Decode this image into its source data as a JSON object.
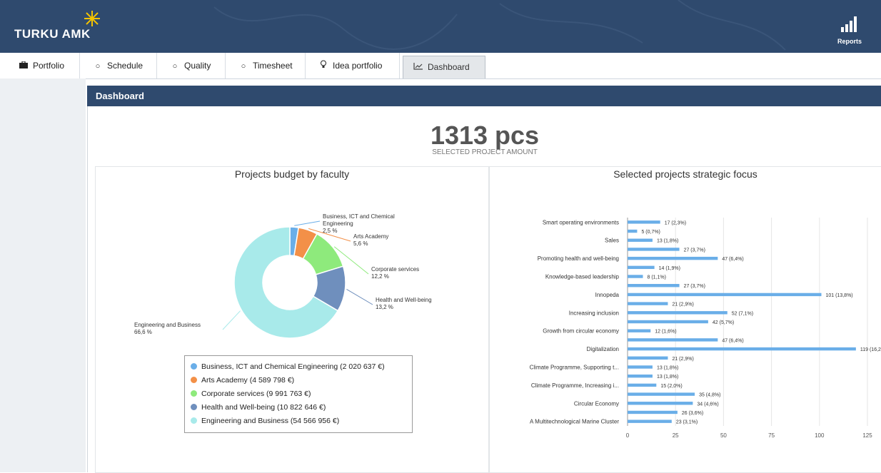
{
  "header": {
    "logo_text": "TURKU AMK",
    "reports_label": "Reports",
    "colors": {
      "bar": "#2f4a6e",
      "accent": "#f5c400"
    }
  },
  "tabs": [
    {
      "label": "Portfolio",
      "icon": "briefcase-icon"
    },
    {
      "label": "Schedule",
      "icon": "circle-icon"
    },
    {
      "label": "Quality",
      "icon": "circle-icon"
    },
    {
      "label": "Timesheet",
      "icon": "circle-icon"
    },
    {
      "label": "Idea portfolio",
      "icon": "lightbulb-icon"
    },
    {
      "label": "Dashboard",
      "icon": "line-chart-icon",
      "active": true
    }
  ],
  "panel": {
    "title": "Dashboard"
  },
  "summary": {
    "value": "1313 pcs",
    "label": "SELECTED PROJECT AMOUNT"
  },
  "chart_data": [
    {
      "type": "pie",
      "title": "Projects budget by faculty",
      "slices": [
        {
          "name": "Business, ICT and Chemical Engineering",
          "label": "Business, ICT and Chemical Engineering",
          "pct_label": "2,5 %",
          "value": 2.5,
          "legend": "Business, ICT and Chemical Engineering (2 020 637 €)",
          "color": "#6aaee8"
        },
        {
          "name": "Arts Academy",
          "label": "Arts Academy",
          "pct_label": "5,6 %",
          "value": 5.6,
          "legend": "Arts Academy (4 589 798 €)",
          "color": "#f39048"
        },
        {
          "name": "Corporate services",
          "label": "Corporate services",
          "pct_label": "12,2 %",
          "value": 12.2,
          "legend": "Corporate services (9 991 763 €)",
          "color": "#8eea7c"
        },
        {
          "name": "Health and Well-being",
          "label": "Health and Well-being",
          "pct_label": "13,2 %",
          "value": 13.2,
          "legend": "Health and Well-being (10 822 646 €)",
          "color": "#6f8fbd"
        },
        {
          "name": "Engineering and Business",
          "label": "Engineering and Business",
          "pct_label": "66,6 %",
          "value": 66.6,
          "legend": "Engineering and Business (54 566 956 €)",
          "color": "#a8eaea"
        }
      ]
    },
    {
      "type": "bar",
      "title": "Selected projects strategic focus",
      "orientation": "horizontal",
      "xlim": [
        0,
        125
      ],
      "xticks": [
        0,
        25,
        50,
        75,
        100,
        125
      ],
      "color": "#6aaee8",
      "bars": [
        {
          "category": "Smart operating environments",
          "value": 17,
          "label": "17 (2,3%)"
        },
        {
          "category": "",
          "value": 5,
          "label": "5 (0,7%)"
        },
        {
          "category": "Sales",
          "value": 13,
          "label": "13 (1,8%)"
        },
        {
          "category": "",
          "value": 27,
          "label": "27 (3,7%)"
        },
        {
          "category": "Promoting health and well-being",
          "value": 47,
          "label": "47 (6,4%)"
        },
        {
          "category": "",
          "value": 14,
          "label": "14 (1,9%)"
        },
        {
          "category": "Knowledge-based leadership",
          "value": 8,
          "label": "8 (1,1%)"
        },
        {
          "category": "",
          "value": 27,
          "label": "27 (3,7%)"
        },
        {
          "category": "Innopeda",
          "value": 101,
          "label": "101 (13,8%)"
        },
        {
          "category": "",
          "value": 21,
          "label": "21 (2,9%)"
        },
        {
          "category": "Increasing inclusion",
          "value": 52,
          "label": "52 (7,1%)"
        },
        {
          "category": "",
          "value": 42,
          "label": "42 (5,7%)"
        },
        {
          "category": "Growth from circular economy",
          "value": 12,
          "label": "12 (1,6%)"
        },
        {
          "category": "",
          "value": 47,
          "label": "47 (6,4%)"
        },
        {
          "category": "Digitalization",
          "value": 119,
          "label": "119 (16,2%)"
        },
        {
          "category": "",
          "value": 21,
          "label": "21 (2,9%)"
        },
        {
          "category": "Climate Programme, Supporting t...",
          "value": 13,
          "label": "13 (1,8%)"
        },
        {
          "category": "",
          "value": 13,
          "label": "13 (1,8%)"
        },
        {
          "category": "Climate Programme, Increasing i...",
          "value": 15,
          "label": "15 (2,0%)"
        },
        {
          "category": "",
          "value": 35,
          "label": "35 (4,8%)"
        },
        {
          "category": "Circular Economy",
          "value": 34,
          "label": "34 (4,6%)"
        },
        {
          "category": "",
          "value": 26,
          "label": "26 (3,6%)"
        },
        {
          "category": "A Multitechnological Marine Cluster",
          "value": 23,
          "label": "23 (3,1%)"
        }
      ]
    }
  ]
}
